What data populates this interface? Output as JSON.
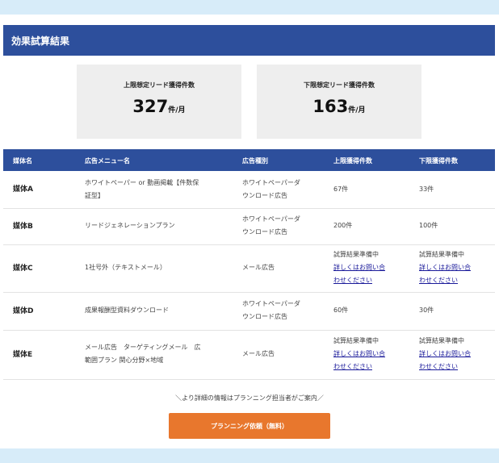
{
  "section_title": "効果試算結果",
  "summary": {
    "upper": {
      "label": "上限想定リード獲得件数",
      "value": "327",
      "unit": "件/月"
    },
    "lower": {
      "label": "下限想定リード獲得件数",
      "value": "163",
      "unit": "件/月"
    }
  },
  "table": {
    "headers": [
      "媒体名",
      "広告メニュー名",
      "広告種別",
      "上限獲得件数",
      "下限獲得件数"
    ],
    "rows": [
      {
        "media": "媒体A",
        "menu": [
          "ホワイトペーパー or 動画掲載【件数保",
          "証型】"
        ],
        "type": [
          "ホワイトペーパーダ",
          "ウンロード広告"
        ],
        "upper": "67件",
        "lower": "33件"
      },
      {
        "media": "媒体B",
        "menu": [
          "リードジェネレーションプラン"
        ],
        "type": [
          "ホワイトペーパーダ",
          "ウンロード広告"
        ],
        "upper": "200件",
        "lower": "100件"
      },
      {
        "media": "媒体C",
        "menu": [
          "1社号外（テキストメール）"
        ],
        "type": [
          "メール広告"
        ],
        "upper_pending": "試算結果準備中",
        "upper_link": [
          "詳しくはお問い合",
          "わせください"
        ],
        "lower_pending": "試算結果準備中",
        "lower_link": [
          "詳しくはお問い合",
          "わせください"
        ]
      },
      {
        "media": "媒体D",
        "menu": [
          "成果報酬型資料ダウンロード"
        ],
        "type": [
          "ホワイトペーパーダ",
          "ウンロード広告"
        ],
        "upper": "60件",
        "lower": "30件"
      },
      {
        "media": "媒体E",
        "menu": [
          "メール広告　ターゲティングメール　広",
          "範囲プラン 関心分野×地域"
        ],
        "type": [
          "メール広告"
        ],
        "upper_pending": "試算結果準備中",
        "upper_link": [
          "詳しくはお問い合",
          "わせください"
        ],
        "lower_pending": "試算結果準備中",
        "lower_link": [
          "詳しくはお問い合",
          "わせください"
        ]
      }
    ]
  },
  "note": "＼より詳細の情報はプランニング担当者がご案内／",
  "cta_label": "プランニング依頼（無料）",
  "colors": {
    "header": "#2d4f9c",
    "cta": "#e8772d",
    "background": "#d7ecf9"
  }
}
